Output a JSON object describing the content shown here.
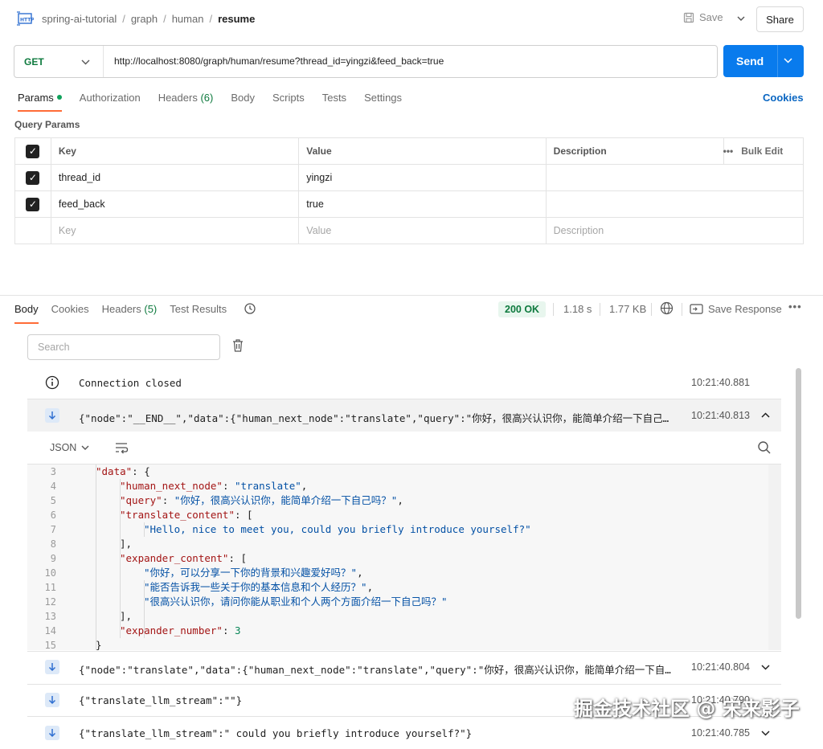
{
  "breadcrumb": {
    "items": [
      "spring-ai-tutorial",
      "graph",
      "human"
    ],
    "current": "resume"
  },
  "header": {
    "save_label": "Save",
    "share_label": "Share"
  },
  "request": {
    "method": "GET",
    "url": "http://localhost:8080/graph/human/resume?thread_id=yingzi&feed_back=true",
    "send_label": "Send"
  },
  "request_tabs": [
    "Params",
    "Authorization",
    "Headers",
    "Body",
    "Scripts",
    "Tests",
    "Settings"
  ],
  "headers_count": "(6)",
  "cookies_label": "Cookies",
  "query_params": {
    "title": "Query Params",
    "columns": [
      "Key",
      "Value",
      "Description"
    ],
    "bulk_edit": "Bulk Edit",
    "rows": [
      {
        "key": "thread_id",
        "value": "yingzi",
        "description": ""
      },
      {
        "key": "feed_back",
        "value": "true",
        "description": ""
      }
    ],
    "placeholder": {
      "key": "Key",
      "value": "Value",
      "description": "Description"
    }
  },
  "response": {
    "tabs": [
      "Body",
      "Cookies",
      "Headers",
      "Test Results"
    ],
    "headers_count": "(5)",
    "status": "200 OK",
    "time": "1.18 s",
    "size": "1.77 KB",
    "save_response": "Save Response",
    "search_placeholder": "Search"
  },
  "events": [
    {
      "type": "info",
      "text": "Connection closed",
      "time": "10:21:40.881"
    },
    {
      "type": "message",
      "text": "{\"node\":\"__END__\",\"data\":{\"human_next_node\":\"translate\",\"query\":\"你好，很高兴认识你，能简单介绍一下自己吗？\"...",
      "time": "10:21:40.813"
    },
    {
      "type": "message",
      "text": "{\"node\":\"translate\",\"data\":{\"human_next_node\":\"translate\",\"query\":\"你好，很高兴认识你，能简单介绍一下自己吗...",
      "time": "10:21:40.804"
    },
    {
      "type": "message",
      "text": "{\"translate_llm_stream\":\"\"}",
      "time": "10:21:40.790"
    },
    {
      "type": "message",
      "text": "{\"translate_llm_stream\":\" could you briefly introduce yourself?\"}",
      "time": "10:21:40.785"
    }
  ],
  "json_viewer": {
    "format": "JSON",
    "lines": [
      {
        "n": "3",
        "indent": 1,
        "parts": [
          [
            "k",
            "\"data\""
          ],
          [
            "p",
            ": {"
          ]
        ]
      },
      {
        "n": "4",
        "indent": 2,
        "parts": [
          [
            "k",
            "\"human_next_node\""
          ],
          [
            "p",
            ": "
          ],
          [
            "s",
            "\"translate\""
          ],
          [
            "p",
            ","
          ]
        ]
      },
      {
        "n": "5",
        "indent": 2,
        "parts": [
          [
            "k",
            "\"query\""
          ],
          [
            "p",
            ": "
          ],
          [
            "s",
            "\"你好，很高兴认识你，能简单介绍一下自己吗？\""
          ],
          [
            "p",
            ","
          ]
        ]
      },
      {
        "n": "6",
        "indent": 2,
        "parts": [
          [
            "k",
            "\"translate_content\""
          ],
          [
            "p",
            ": ["
          ]
        ]
      },
      {
        "n": "7",
        "indent": 3,
        "parts": [
          [
            "s",
            "\"Hello, nice to meet you, could you briefly introduce yourself?\""
          ]
        ]
      },
      {
        "n": "8",
        "indent": 2,
        "parts": [
          [
            "p",
            "],"
          ]
        ]
      },
      {
        "n": "9",
        "indent": 2,
        "parts": [
          [
            "k",
            "\"expander_content\""
          ],
          [
            "p",
            ": ["
          ]
        ]
      },
      {
        "n": "10",
        "indent": 3,
        "parts": [
          [
            "s",
            "\"你好，可以分享一下你的背景和兴趣爱好吗？\""
          ],
          [
            "p",
            ","
          ]
        ]
      },
      {
        "n": "11",
        "indent": 3,
        "parts": [
          [
            "s",
            "\"能否告诉我一些关于你的基本信息和个人经历？\""
          ],
          [
            "p",
            ","
          ]
        ]
      },
      {
        "n": "12",
        "indent": 3,
        "parts": [
          [
            "s",
            "\"很高兴认识你，请问你能从职业和个人两个方面介绍一下自己吗？\""
          ]
        ]
      },
      {
        "n": "13",
        "indent": 2,
        "parts": [
          [
            "p",
            "],"
          ]
        ]
      },
      {
        "n": "14",
        "indent": 2,
        "parts": [
          [
            "k",
            "\"expander_number\""
          ],
          [
            "p",
            ": "
          ],
          [
            "n",
            "3"
          ]
        ]
      },
      {
        "n": "15",
        "indent": 1,
        "parts": [
          [
            "p",
            "}"
          ]
        ]
      }
    ]
  },
  "watermark": "掘金技术社区 @ 宋来影子",
  "colors": {
    "send": "#097bed",
    "accent_tab": "#ff6c37",
    "method": "#0e7a3e",
    "status_bg": "#e8f6ee"
  }
}
